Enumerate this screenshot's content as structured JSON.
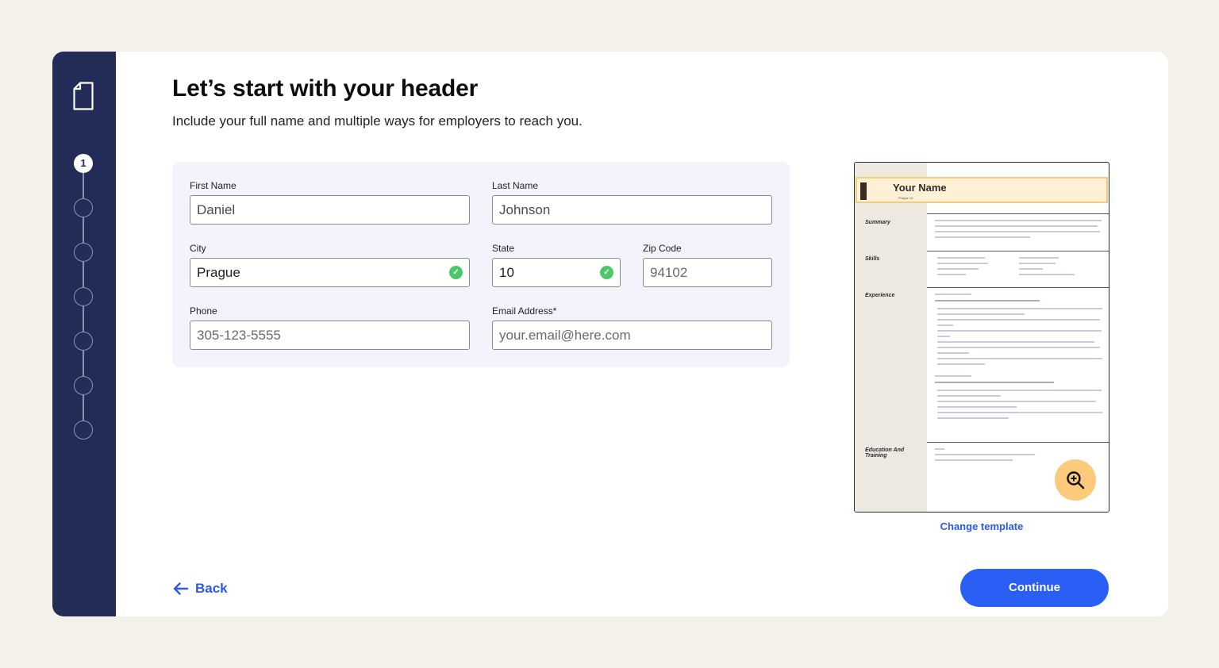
{
  "header": {
    "title": "Let’s start with your header",
    "subtitle": "Include your full name and multiple ways for employers to reach you."
  },
  "sidebar": {
    "current_step": "1",
    "total_steps": 7
  },
  "form": {
    "first_name": {
      "label": "First Name",
      "value": "Daniel"
    },
    "last_name": {
      "label": "Last Name",
      "value": "Johnson"
    },
    "city": {
      "label": "City",
      "value": "Prague",
      "valid": true
    },
    "state": {
      "label": "State",
      "value": "10",
      "valid": true
    },
    "zip": {
      "label": "Zip Code",
      "placeholder": "94102"
    },
    "phone": {
      "label": "Phone",
      "placeholder": "305-123-5555"
    },
    "email": {
      "label": "Email Address*",
      "placeholder": "your.email@here.com"
    }
  },
  "preview": {
    "name": "Your Name",
    "location": "Prague 10",
    "sections": [
      "Summary",
      "Skills",
      "Experience",
      "Education And Training"
    ],
    "change_template_label": "Change template"
  },
  "footer": {
    "back_label": "Back",
    "continue_label": "Continue"
  },
  "colors": {
    "sidebar": "#222c57",
    "accent": "#2a5ff6",
    "link": "#2a5ae6",
    "form_bg": "#f2f3fb",
    "check": "#4bc86a",
    "zoom_bg": "#fbca7a"
  }
}
